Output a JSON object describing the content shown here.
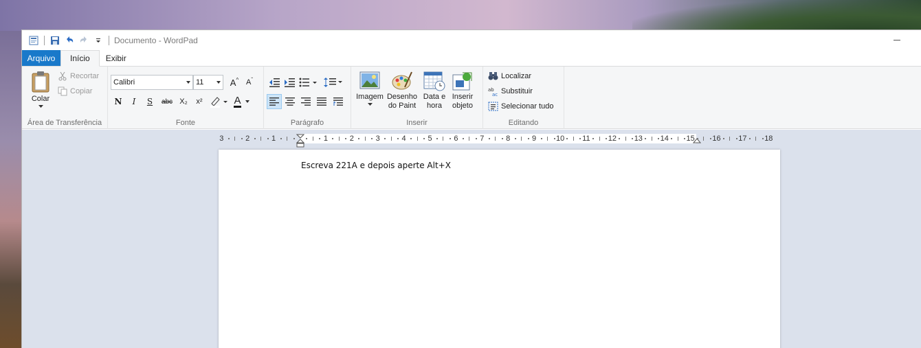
{
  "window": {
    "title": "Documento - WordPad"
  },
  "tabs": [
    {
      "label": "Arquivo"
    },
    {
      "label": "Início"
    },
    {
      "label": "Exibir"
    }
  ],
  "clipboard": {
    "paste": "Colar",
    "cut": "Recortar",
    "copy": "Copiar",
    "group_label": "Área de Transferência"
  },
  "font": {
    "family": "Calibri",
    "size": "11",
    "bold": "N",
    "italic": "I",
    "underline": "S",
    "strike": "abc",
    "subscript": "X₂",
    "superscript": "x²",
    "color_letter": "A",
    "grow": "A",
    "shrink": "A",
    "group_label": "Fonte"
  },
  "paragraph": {
    "group_label": "Parágrafo"
  },
  "insert": {
    "image": "Imagem",
    "paint_line1": "Desenho",
    "paint_line2": "do Paint",
    "datetime_line1": "Data e",
    "datetime_line2": "hora",
    "object_line1": "Inserir",
    "object_line2": "objeto",
    "group_label": "Inserir"
  },
  "editing": {
    "find": "Localizar",
    "replace": "Substituir",
    "select_all": "Selecionar tudo",
    "group_label": "Editando"
  },
  "ruler": {
    "labels": [
      "3",
      "2",
      "1",
      "1",
      "2",
      "3",
      "4",
      "5",
      "6",
      "7",
      "8",
      "9",
      "10",
      "11",
      "12",
      "13",
      "14",
      "15",
      "16",
      "17",
      "18"
    ]
  },
  "document": {
    "text": "Escreva 221A e depois aperte Alt+X"
  },
  "colors": {
    "file_tab": "#1979ca",
    "ribbon_bg": "#f5f6f7",
    "doc_bg": "#dbe1ec",
    "font_color_bar": "#1a1a1a"
  }
}
